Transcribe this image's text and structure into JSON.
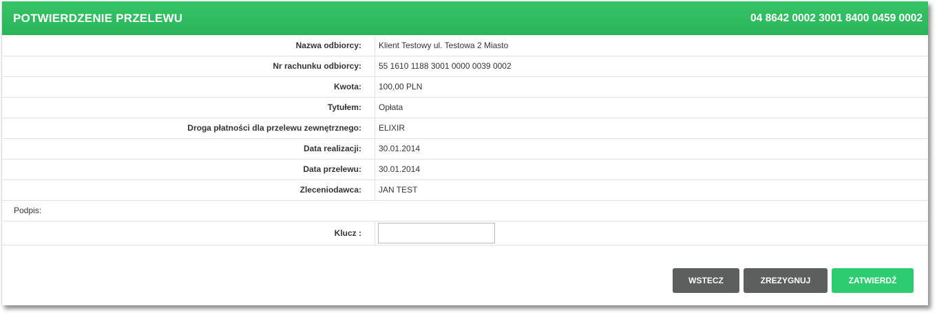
{
  "header": {
    "title": "POTWIERDZENIE PRZELEWU",
    "account_number": "04 8642 0002 3001 8400 0459 0002"
  },
  "details": [
    {
      "label": "Nazwa odbiorcy:",
      "value": "Klient Testowy ul. Testowa 2 Miasto"
    },
    {
      "label": "Nr rachunku odbiorcy:",
      "value": "55 1610 1188 3001 0000 0039 0002"
    },
    {
      "label": "Kwota:",
      "value": "100,00 PLN"
    },
    {
      "label": "Tytułem:",
      "value": "Opłata"
    },
    {
      "label": "Droga płatności dla przelewu zewnętrznego:",
      "value": "ELIXIR"
    },
    {
      "label": "Data realizacji:",
      "value": "30.01.2014"
    },
    {
      "label": "Data przelewu:",
      "value": "30.01.2014"
    },
    {
      "label": "Zleceniodawca:",
      "value": "JAN TEST"
    }
  ],
  "signature": {
    "section_label": "Podpis:",
    "key_label": "Klucz :",
    "key_value": ""
  },
  "buttons": {
    "back": "WSTECZ",
    "cancel": "ZREZYGNUJ",
    "confirm": "ZATWIERDŹ"
  },
  "colors": {
    "header_green": "#2eb862",
    "button_gray": "#5b5f5e",
    "button_green": "#2ecc71"
  }
}
